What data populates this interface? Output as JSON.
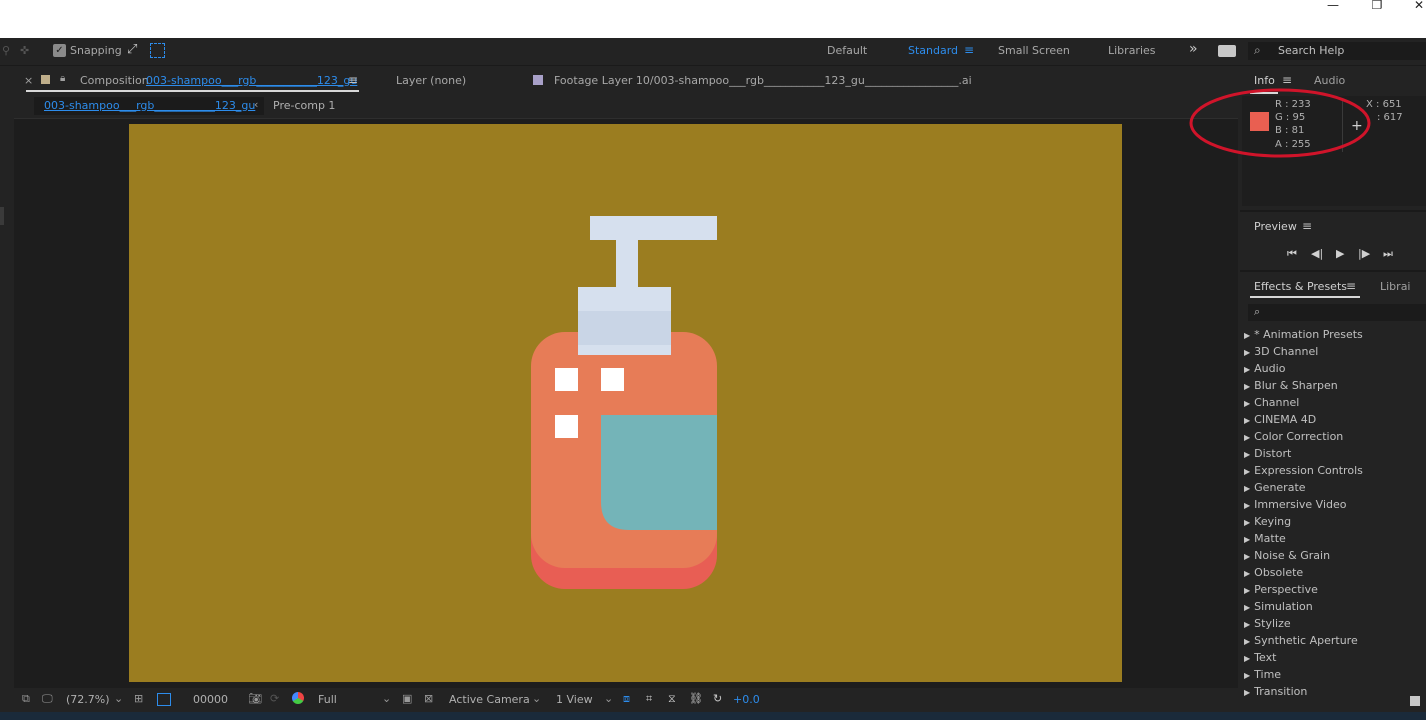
{
  "window": {
    "minimize_glyph": "—",
    "restore_glyph": "❐",
    "close_glyph": "✕"
  },
  "toolbar": {
    "snapping_label": "Snapping",
    "workspaces": [
      "Default",
      "Standard",
      "Small Screen",
      "Libraries"
    ],
    "active_workspace": "Standard",
    "search_placeholder": "Search Help"
  },
  "comp_tabs": {
    "composition_prefix": "Composition",
    "composition_name": "003-shampoo___rgb___________123_gu",
    "layer_tab": "Layer  (none)",
    "footage_tab": "Footage  Layer 10/003-shampoo___rgb___________123_gu_________________.ai",
    "breadcrumb_current": "003-shampoo___rgb___________123_gu",
    "breadcrumb_next": "Pre-comp 1"
  },
  "colors": {
    "viewer_bg": "#9b7d20",
    "bottle_body": "#e77c57",
    "bottle_bottom": "#e85e54",
    "label": "#74b4b8",
    "pump": "#d6e0ee",
    "pump_neck": "#c9d5e6",
    "sample_swatch": "#e95f51",
    "annotation_red": "#d0142a",
    "accent": "#2d8ceb"
  },
  "bottom_bar": {
    "zoom": "(72.7%)",
    "timecode": "00000",
    "resolution": "Full",
    "camera": "Active Camera",
    "views": "1 View",
    "exposure": "+0.0"
  },
  "info_panel": {
    "tab_info": "Info",
    "tab_audio": "Audio",
    "r": "R :  233",
    "g": "G :  95",
    "b": "B :  81",
    "a": "A :  255",
    "x": "X :  651",
    "y": ":  617"
  },
  "preview_panel": {
    "title": "Preview"
  },
  "effects_panel": {
    "title": "Effects & Presets",
    "libraries_tab": "Librai",
    "items": [
      "* Animation Presets",
      "3D Channel",
      "Audio",
      "Blur & Sharpen",
      "Channel",
      "CINEMA 4D",
      "Color Correction",
      "Distort",
      "Expression Controls",
      "Generate",
      "Immersive Video",
      "Keying",
      "Matte",
      "Noise & Grain",
      "Obsolete",
      "Perspective",
      "Simulation",
      "Stylize",
      "Synthetic Aperture",
      "Text",
      "Time",
      "Transition"
    ]
  }
}
